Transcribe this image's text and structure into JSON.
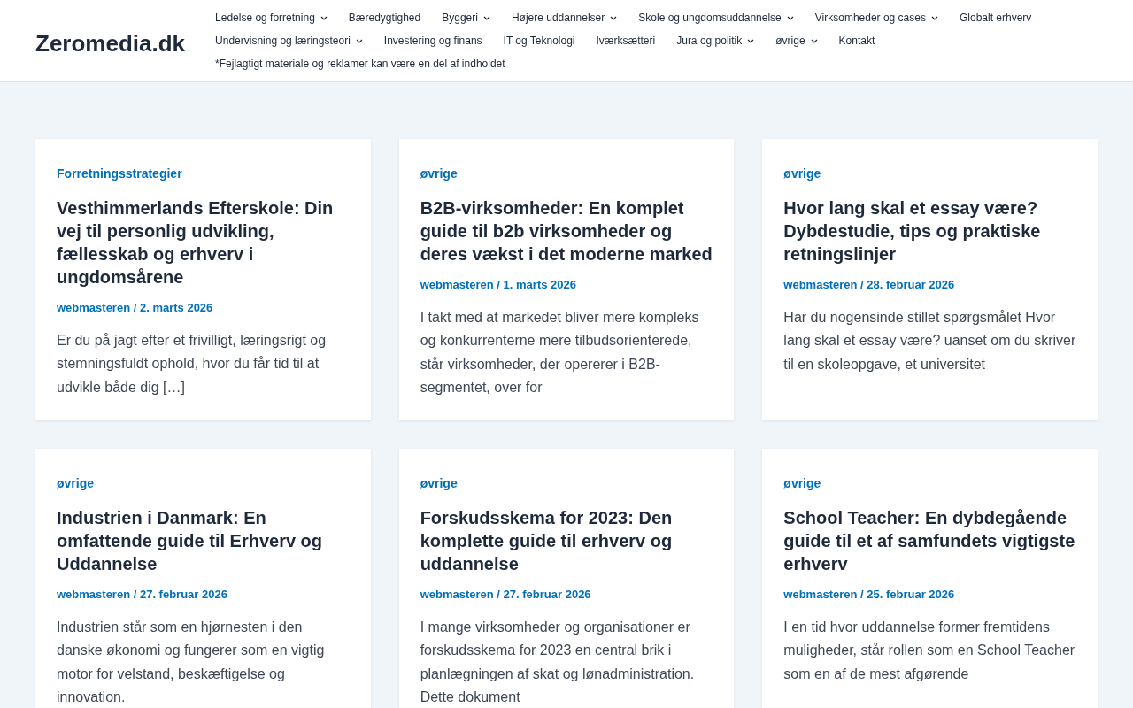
{
  "site_title": "Zeromedia.dk",
  "menu": [
    {
      "label": "Ledelse og forretning",
      "has_submenu": true
    },
    {
      "label": "Bæredygtighed",
      "has_submenu": false
    },
    {
      "label": "Byggeri",
      "has_submenu": true
    },
    {
      "label": "Højere uddannelser",
      "has_submenu": true
    },
    {
      "label": "Skole og ungdomsuddannelse",
      "has_submenu": true
    },
    {
      "label": "Virksomheder og cases",
      "has_submenu": true
    },
    {
      "label": "Globalt erhverv",
      "has_submenu": false
    },
    {
      "label": "Undervisning og læringsteori",
      "has_submenu": true
    },
    {
      "label": "Investering og finans",
      "has_submenu": false
    },
    {
      "label": "IT og Teknologi",
      "has_submenu": false
    },
    {
      "label": "Iværksætteri",
      "has_submenu": false
    },
    {
      "label": "Jura og politik",
      "has_submenu": true
    },
    {
      "label": "øvrige",
      "has_submenu": true
    },
    {
      "label": "Kontakt",
      "has_submenu": false
    },
    {
      "label": "*Fejlagtigt materiale og reklamer kan være en del af indholdet",
      "has_submenu": false
    }
  ],
  "posts": [
    {
      "category": "Forretningsstrategier",
      "title": "Vesthimmerlands Efterskole: Din vej til personlig udvikling, fællesskab og erhverv i ungdomsårene",
      "meta": "webmasteren / 2. marts 2026",
      "excerpt": "Er du på jagt efter et frivilligt, læringsrigt og stemningsfuldt ophold, hvor du får tid til at udvikle både dig […]"
    },
    {
      "category": "øvrige",
      "title": "B2B-virksomheder: En komplet guide til b2b virksomheder og deres vækst i det moderne marked",
      "meta": "webmasteren / 1. marts 2026",
      "excerpt": "I takt med at markedet bliver mere kompleks og konkurrenterne mere tilbudsorienterede, står virksomheder, der opererer i B2B-segmentet, over for"
    },
    {
      "category": "øvrige",
      "title": "Hvor lang skal et essay være? Dybdestudie, tips og praktiske retningslinjer",
      "meta": "webmasteren / 28. februar 2026",
      "excerpt": "Har du nogensinde stillet spørgsmålet Hvor lang skal et essay være? uanset om du skriver til en skoleopgave, et universitet"
    },
    {
      "category": "øvrige",
      "title": "Industrien i Danmark: En omfattende guide til Erhverv og Uddannelse",
      "meta": "webmasteren / 27. februar 2026",
      "excerpt": "Industrien står som en hjørnesten i den danske økonomi og fungerer som en vigtig motor for velstand, beskæftigelse og innovation."
    },
    {
      "category": "øvrige",
      "title": "Forskudsskema for 2023: Den komplette guide til erhverv og uddannelse",
      "meta": "webmasteren / 27. februar 2026",
      "excerpt": "I mange virksomheder og organisationer er forskudsskema for 2023 en central brik i planlægningen af skat og lønadministration. Dette dokument"
    },
    {
      "category": "øvrige",
      "title": "School Teacher: En dybdegående guide til et af samfundets vigtigste erhverv",
      "meta": "webmasteren / 25. februar 2026",
      "excerpt": "I en tid hvor uddannelse former fremtidens muligheder, står rollen som en School Teacher som en af de mest afgørende"
    }
  ]
}
